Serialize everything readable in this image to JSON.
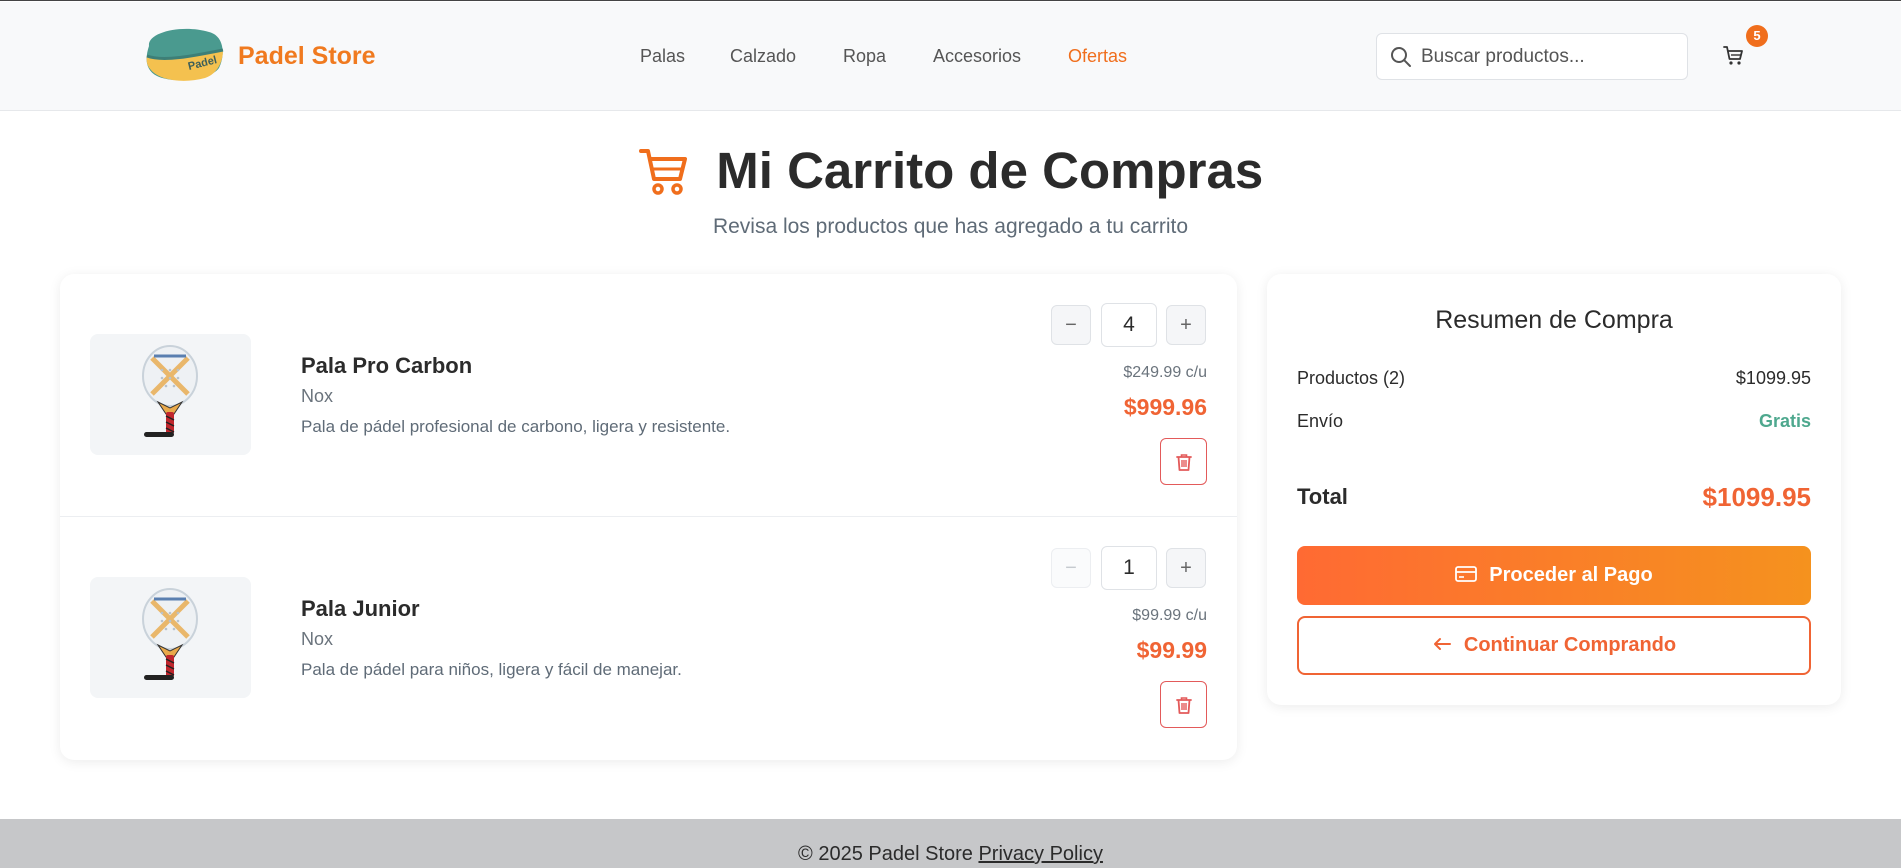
{
  "header": {
    "brand": "Padel Store",
    "logo_text": "Padel",
    "nav": [
      {
        "label": "Palas"
      },
      {
        "label": "Calzado"
      },
      {
        "label": "Ropa"
      },
      {
        "label": "Accesorios"
      },
      {
        "label": "Ofertas"
      }
    ],
    "search": {
      "placeholder": "Buscar productos...",
      "value": ""
    },
    "cart_count": "5",
    "icons": [
      "search-icon",
      "cart-icon"
    ]
  },
  "page": {
    "title": "Mi Carrito de Compras",
    "subtitle": "Revisa los productos que has agregado a tu carrito"
  },
  "cart": {
    "items": [
      {
        "name": "Pala Pro Carbon",
        "brand": "Nox",
        "description": "Pala de pádel profesional de carbono, ligera y resistente.",
        "quantity": "4",
        "unit_price": "$249.99 c/u",
        "total": "$999.96",
        "minus": "−",
        "plus": "+"
      },
      {
        "name": "Pala Junior",
        "brand": "Nox",
        "description": "Pala de pádel para niños, ligera y fácil de manejar.",
        "quantity": "1",
        "unit_price": "$99.99 c/u",
        "total": "$99.99",
        "minus": "−",
        "plus": "+"
      }
    ]
  },
  "summary": {
    "title": "Resumen de Compra",
    "products_label": "Productos (2)",
    "products_value": "$1099.95",
    "shipping_label": "Envío",
    "shipping_value": "Gratis",
    "total_label": "Total",
    "total_value": "$1099.95",
    "pay_button": "Proceder al Pago",
    "continue_button": "Continuar Comprando"
  },
  "footer": {
    "copyright": "© 2025 Padel Store",
    "privacy": "Privacy Policy"
  },
  "colors": {
    "accent": "#f06e1c",
    "price": "#f06434",
    "free": "#4ea88e",
    "delete": "#e35a5a"
  }
}
